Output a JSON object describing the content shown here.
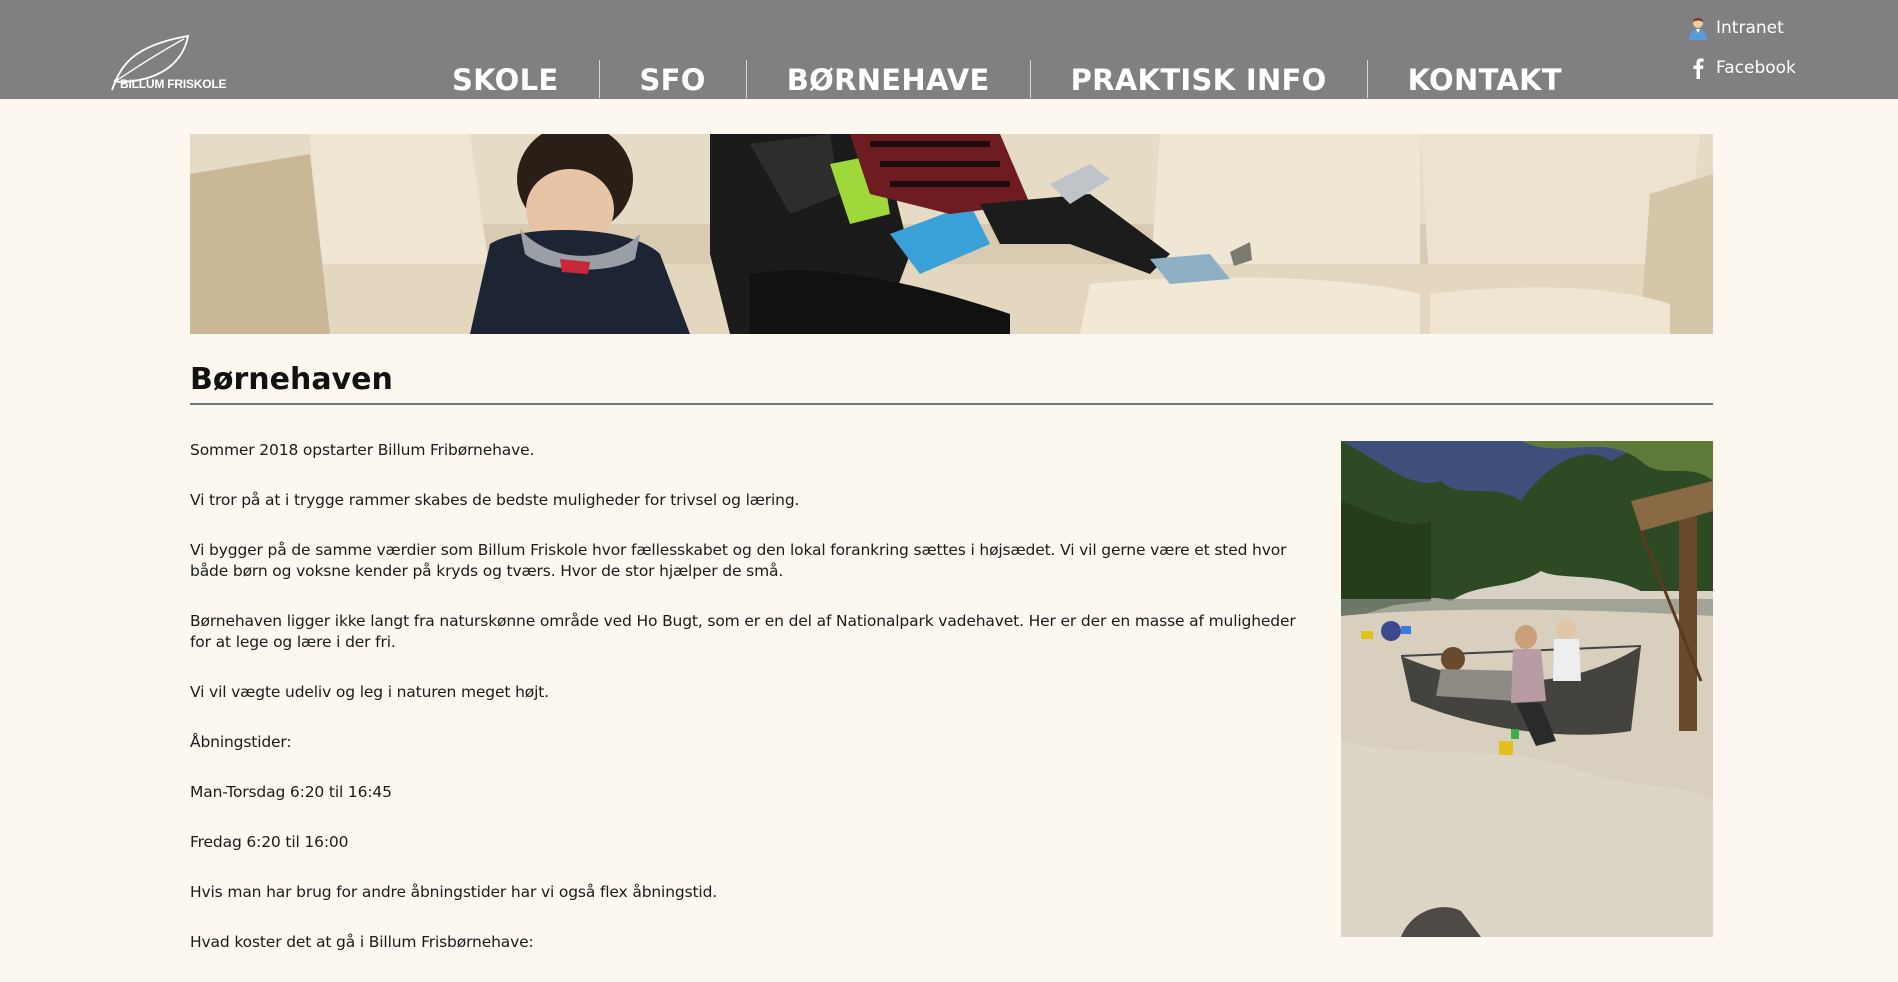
{
  "header": {
    "logo_text": "BILLUM FRISKOLE",
    "nav": [
      {
        "label": "SKOLE"
      },
      {
        "label": "SFO"
      },
      {
        "label": "BØRNEHAVE"
      },
      {
        "label": "PRAKTISK INFO"
      },
      {
        "label": "KONTAKT"
      }
    ],
    "links": {
      "intranet": {
        "label": "Intranet",
        "icon": "user-icon"
      },
      "facebook": {
        "label": "Facebook",
        "icon": "facebook-icon"
      }
    }
  },
  "main": {
    "title": "Børnehaven",
    "paragraphs": [
      "Sommer 2018 opstarter Billum Fribørnehave.",
      "Vi tror på at i trygge rammer skabes de bedste muligheder for trivsel og læring.",
      "Vi bygger på de samme værdier som Billum Friskole hvor fællesskabet og den lokal forankring sættes i højsædet. Vi vil gerne være et sted hvor både børn og voksne kender på kryds og tværs. Hvor de stor hjælper de små.",
      "Børnehaven ligger ikke langt fra naturskønne område ved Ho Bugt, som er en del af Nationalpark vadehavet. Her er der en masse af muligheder for at lege og lære i der fri.",
      "Vi vil vægte udeliv og leg i naturen meget højt.",
      "Åbningstider:",
      "Man-Torsdag 6:20 til 16:45",
      "Fredag 6:20 til 16:00",
      "Hvis man har brug for andre åbningstider har vi også flex åbningstid.",
      "Hvad koster det at gå i Billum Frisbørnehave:"
    ]
  },
  "colors": {
    "header_bg": "#808080",
    "page_bg": "#fcf8ef",
    "rule": "#6f7680"
  }
}
